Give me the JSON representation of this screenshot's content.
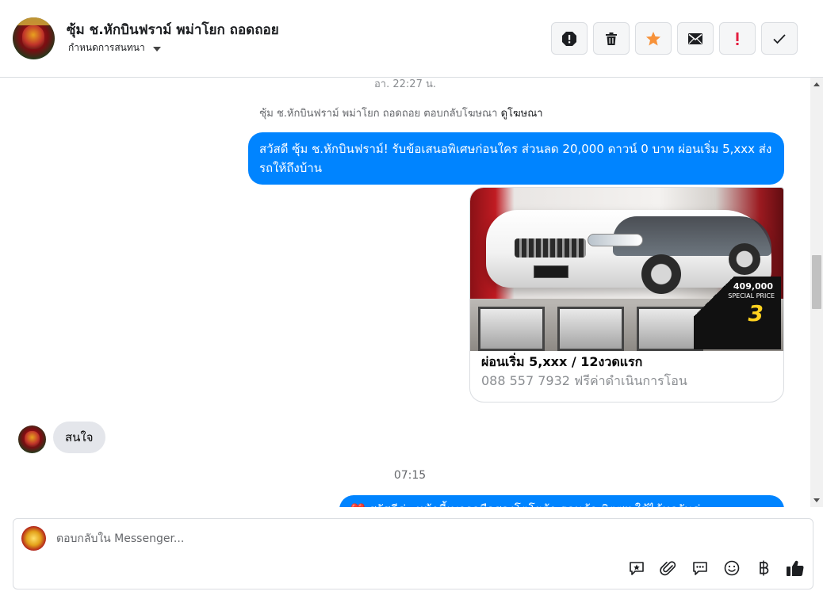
{
  "header": {
    "title": "ซุ้ม ช.หักบินฟราม์ พม่าโยก ถอดถอย",
    "subtitle": "กำหนดการสนทนา"
  },
  "conversation": {
    "timestamp_top": "อา. 22:27 น.",
    "reply_note_prefix": "ซุ้ม ช.หักบินฟราม์ พม่าโยก ถอดถอย ตอบกลับโฆษณา",
    "reply_note_link": "ดูโฆษณา",
    "outgoing_message": "สวัสดี ซุ้ม ช.หักบินฟราม์! รับข้อเสนอพิเศษก่อนใคร ส่วนลด 20,000 ดาวน์ 0 บาท ผ่อนเริ่ม 5,xxx  ส่งรถให้ถึงบ้าน",
    "ad_card": {
      "title": "ผ่อนเริ่ม 5,xxx / 12งวดแรก",
      "subtitle": "088 557 7932 ฟรีค่าดำเนินการโอน",
      "promo_price": "409,000",
      "promo_tag": "SPECIAL PRICE",
      "promo_number": "3"
    },
    "incoming_message": "สนใจ",
    "timestamp_mid": "07:15",
    "partial_message": "❤️ สวัสดีค่ะ หน้านี้เพจรถมือสองโตโยต้า ฮอนด้า มิตซูฯ ใช้ได้ทุกวันค่ะ"
  },
  "composer": {
    "placeholder": "ตอบกลับใน Messenger..."
  },
  "icons": {
    "header_actions": [
      "report-icon",
      "trash-icon",
      "star-icon",
      "mail-icon",
      "exclamation-icon",
      "check-icon"
    ],
    "composer_tools": [
      "saved-reply-icon",
      "attach-icon",
      "chat-icon",
      "emoji-icon",
      "baht-icon",
      "like-icon"
    ]
  },
  "colors": {
    "outgoing_bubble": "#0084ff",
    "incoming_bubble": "#e4e6eb",
    "star": "#f7923a",
    "exclamation": "#e41e3f"
  }
}
